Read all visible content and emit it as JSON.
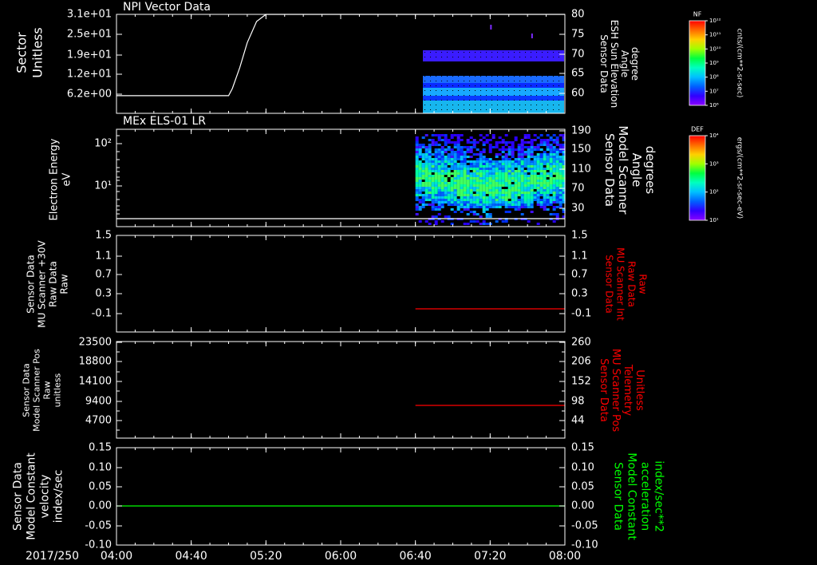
{
  "date_label": "2017/250",
  "colors": {
    "white": "#ffffff",
    "red": "#ff0000",
    "green": "#00ff00"
  },
  "time_axis": {
    "start": "04:00",
    "end": "08:00",
    "range_minutes": [
      0,
      240
    ],
    "ticks": [
      {
        "label": "04:00",
        "minute": 0
      },
      {
        "label": "04:40",
        "minute": 40
      },
      {
        "label": "05:20",
        "minute": 80
      },
      {
        "label": "06:00",
        "minute": 120
      },
      {
        "label": "06:40",
        "minute": 160
      },
      {
        "label": "07:20",
        "minute": 200
      },
      {
        "label": "08:00",
        "minute": 240
      }
    ]
  },
  "chart_data": [
    {
      "type": "heatmap",
      "title": "NPI Vector Data",
      "ylabel": [
        "Sector",
        "Unitless"
      ],
      "yticks": [
        "3.1e+01",
        "2.5e+01",
        "1.9e+01",
        "1.2e+01",
        "6.2e+00"
      ],
      "y2label": [
        "Sensor Data",
        "ESH Sun Elevation",
        "Angle",
        "degree"
      ],
      "y2ticks": [
        "80",
        "75",
        "70",
        "65",
        "60"
      ],
      "y2lim": [
        52,
        80
      ],
      "line_series": {
        "x_minutes": [
          0,
          60,
          62,
          66,
          70,
          75,
          80,
          82,
          240
        ],
        "y": [
          57,
          57,
          59,
          65,
          72,
          78,
          80,
          80,
          80
        ]
      },
      "data_start_minute": 164,
      "colorbar": {
        "label": "NF",
        "units": "cnts/(cm**2-sr-sec)",
        "ticks": [
          "10¹²",
          "10¹¹",
          "10¹⁰",
          "10⁹",
          "10⁸",
          "10⁷",
          "10⁶"
        ]
      }
    },
    {
      "type": "heatmap",
      "title": "MEx ELS-01 LR",
      "ylabel": [
        "Electron Energy",
        "eV"
      ],
      "yticks": [
        "10²",
        "10¹"
      ],
      "y2label": [
        "Sensor Data",
        "Model Scanner",
        "Angle",
        "degrees"
      ],
      "y2ticks": [
        "190",
        "150",
        "110",
        "70",
        "30"
      ],
      "y2lim": [
        0,
        190
      ],
      "line_series": {
        "x_minutes": [
          0,
          240
        ],
        "y": [
          10,
          10
        ]
      },
      "data_start_minute": 160,
      "colorbar": {
        "label": "DEF",
        "units": "ergs/(cm**2-sr-sec-eV)",
        "ticks": [
          "10⁴",
          "10³",
          "10²",
          "10¹"
        ]
      }
    },
    {
      "type": "line",
      "ylabel": [
        "Sensor Data",
        "MU Scanner +30V",
        "Raw Data",
        "Raw"
      ],
      "yticks": [
        "1.5",
        "1.1",
        "0.7",
        "0.3",
        "-0.1"
      ],
      "ylim": [
        -0.5,
        1.5
      ],
      "y2label": [
        "Sensor Data",
        "MU Scanner Int",
        "Raw Data",
        "Raw"
      ],
      "y2ticks": [
        "1.5",
        "1.1",
        "0.7",
        "0.3",
        "-0.1"
      ],
      "series": [
        {
          "color": "#ff0000",
          "x_minutes": [
            160,
            240
          ],
          "y": [
            -0.05,
            -0.05
          ]
        }
      ]
    },
    {
      "type": "line",
      "ylabel": [
        "Sensor Data",
        "Model Scanner Pos",
        "Raw",
        "unitless"
      ],
      "yticks": [
        "23500",
        "18800",
        "14100",
        "9400",
        "4700"
      ],
      "ylim": [
        0,
        23500
      ],
      "y2label": [
        "Sensor Data",
        "MU Scanner Pos",
        "Telemetry",
        "Unitless"
      ],
      "y2ticks": [
        "260",
        "206",
        "152",
        "98",
        "44"
      ],
      "y2lim": [
        0,
        260
      ],
      "series": [
        {
          "color": "#ff0000",
          "x_minutes": [
            160,
            240
          ],
          "y2": [
            89,
            89
          ]
        }
      ]
    },
    {
      "type": "line",
      "ylabel": [
        "Sensor Data",
        "Model Constant",
        "velocity",
        "index/sec"
      ],
      "yticks": [
        "0.15",
        "0.10",
        "0.05",
        "0.00",
        "-0.05",
        "-0.10"
      ],
      "ylim": [
        -0.1,
        0.15
      ],
      "y2label": [
        "Sensor Data",
        "Model Constant",
        "acceleration",
        "index/sec**2"
      ],
      "y2ticks": [
        "0.15",
        "0.10",
        "0.05",
        "0.00",
        "-0.05",
        "-0.10"
      ],
      "series": [
        {
          "color": "#00ff00",
          "x_minutes": [
            0,
            240
          ],
          "y": [
            0.0,
            0.0
          ]
        }
      ]
    }
  ]
}
